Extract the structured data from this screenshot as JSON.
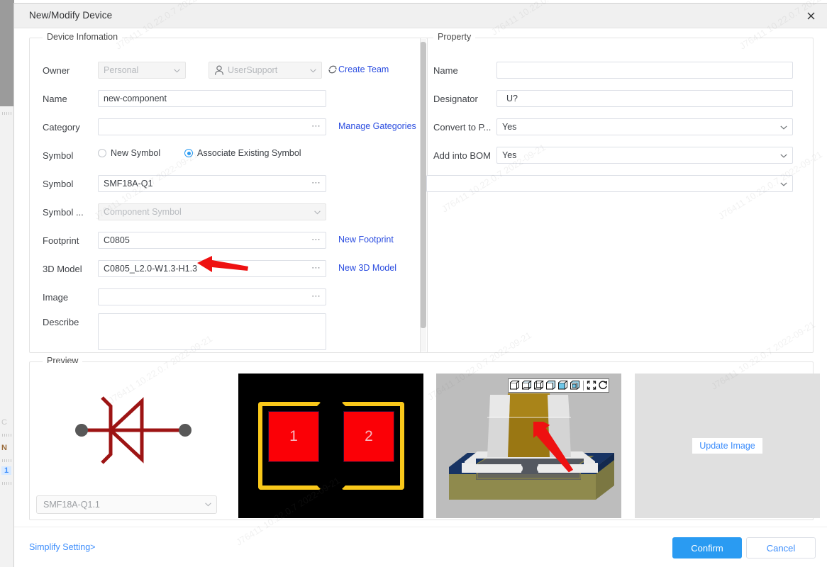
{
  "window": {
    "title": "New/Modify Device",
    "close_icon": "close-icon"
  },
  "device_information": {
    "legend": "Device Infomation",
    "owner": {
      "label": "Owner",
      "scope_value": "Personal",
      "team_value": "UserSupport",
      "refresh_icon": "refresh-icon",
      "user_icon": "user-icon",
      "create_team_link": "Create Team"
    },
    "name": {
      "label": "Name",
      "value": "new-component"
    },
    "category": {
      "label": "Category",
      "value": "",
      "browse_icon": "ellipsis-icon",
      "manage_link": "Manage Gategories"
    },
    "symbol_mode": {
      "label": "Symbol",
      "option_new": "New Symbol",
      "option_existing": "Associate Existing Symbol",
      "selected": "Associate Existing Symbol"
    },
    "symbol": {
      "label": "Symbol",
      "value": "SMF18A-Q1",
      "browse_icon": "ellipsis-icon"
    },
    "symbol_type": {
      "label": "Symbol ...",
      "placeholder": "Component Symbol"
    },
    "footprint": {
      "label": "Footprint",
      "value": "C0805",
      "browse_icon": "ellipsis-icon",
      "link": "New Footprint"
    },
    "model3d": {
      "label": "3D Model",
      "value": "C0805_L2.0-W1.3-H1.3",
      "browse_icon": "ellipsis-icon",
      "link": "New 3D Model"
    },
    "image": {
      "label": "Image",
      "value": "",
      "browse_icon": "ellipsis-icon"
    },
    "describe": {
      "label": "Describe",
      "value": ""
    }
  },
  "property": {
    "legend": "Property",
    "rows": [
      {
        "label": "Name",
        "value": "",
        "type": "text"
      },
      {
        "label": "Designator",
        "value": "U?",
        "type": "text"
      },
      {
        "label": "Convert to P...",
        "value": "Yes",
        "type": "select"
      },
      {
        "label": "Add into BOM",
        "value": "Yes",
        "type": "select"
      }
    ],
    "extra_select": {
      "label": "",
      "value": ""
    }
  },
  "preview": {
    "legend": "Preview",
    "symbol_select": {
      "value": "SMF18A-Q1.1"
    },
    "footprint": {
      "pad1": "1",
      "pad2": "2"
    },
    "viewer3d": {
      "toolbar_icons": [
        "cube-view-iso-icon",
        "cube-view-top-icon",
        "cube-view-front-icon",
        "cube-view-right-icon",
        "cube-view-selected-icon",
        "cube-view-bottom-icon",
        "fullscreen-icon",
        "rotate-icon"
      ]
    },
    "image_panel": {
      "update_button": "Update Image"
    }
  },
  "footer": {
    "simplify_link": "Simplify Setting>",
    "confirm_button": "Confirm",
    "cancel_button": "Cancel"
  },
  "background_strip": {
    "chars": [
      "C",
      "N",
      "1"
    ]
  },
  "colors": {
    "accent_blue": "#2a9bf2",
    "link_blue": "#2b4de0",
    "arrow_red": "#ee1111",
    "pad_red": "#fb0006",
    "courtyard_yellow": "#f9c81a",
    "symbol_dark_red": "#9d1414",
    "pcb_navy": "#183464",
    "pcb_olive": "#8f8a4d",
    "cap_body_gold": "#9a7713"
  },
  "watermarks": [
    "J76411  10.22.0.7  2022-09-21",
    "J76411  10.22.0.7  2022-09-21",
    "J76411  10.22.0.7  2022-09-21",
    "J76411  10.22.0.7  2022-09-21",
    "J76411  10.22.0.7  2022-09-21",
    "J76411  10.22.0.7  2022-09-21",
    "J76411  10.22.0.7  2022-09-21",
    "J76411  10.22.0.7  2022-09-21",
    "J76411  10.22.0.7  2022-09-21",
    "J76411  10.22.0.7  2022-09-21"
  ]
}
